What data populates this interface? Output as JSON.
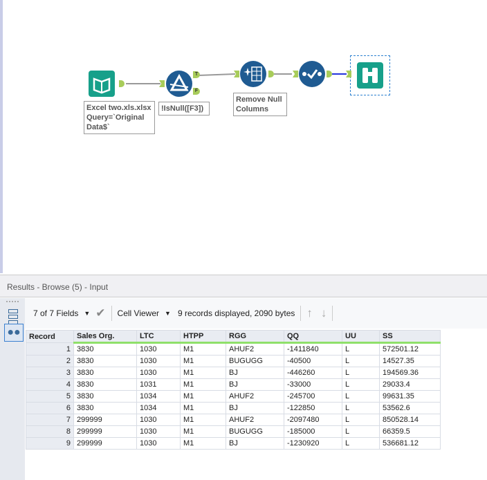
{
  "workflow": {
    "input_label": "Excel two.xls.xlsx Query=`Original Data$`",
    "filter_label": "!IsNull([F3])",
    "filter_true": "T",
    "filter_false": "F",
    "remove_null_label": "Remove Null Columns"
  },
  "results": {
    "title": "Results - Browse (5) - Input",
    "fields": "7 of 7 Fields",
    "viewer": "Cell Viewer",
    "summary": "9 records displayed, 2090 bytes"
  },
  "table": {
    "headers": [
      "Record",
      "Sales Org.",
      "LTC",
      "HTPP",
      "RGG",
      "QQ",
      "UU",
      "SS"
    ],
    "rows": [
      [
        "1",
        "3830",
        "1030",
        "M1",
        "AHUF2",
        "-1411840",
        "L",
        "572501.12"
      ],
      [
        "2",
        "3830",
        "1030",
        "M1",
        "BUGUGG",
        "-40500",
        "L",
        "14527.35"
      ],
      [
        "3",
        "3830",
        "1030",
        "M1",
        "BJ",
        "-446260",
        "L",
        "194569.36"
      ],
      [
        "4",
        "3830",
        "1031",
        "M1",
        "BJ",
        "-33000",
        "L",
        "29033.4"
      ],
      [
        "5",
        "3830",
        "1034",
        "M1",
        "AHUF2",
        "-245700",
        "L",
        "99631.35"
      ],
      [
        "6",
        "3830",
        "1034",
        "M1",
        "BJ",
        "-122850",
        "L",
        "53562.6"
      ],
      [
        "7",
        "299999",
        "1030",
        "M1",
        "AHUF2",
        "-2097480",
        "L",
        "850528.14"
      ],
      [
        "8",
        "299999",
        "1030",
        "M1",
        "BUGUGG",
        "-185000",
        "L",
        "66359.5"
      ],
      [
        "9",
        "299999",
        "1030",
        "M1",
        "BJ",
        "-1230920",
        "L",
        "536681.12"
      ]
    ]
  }
}
